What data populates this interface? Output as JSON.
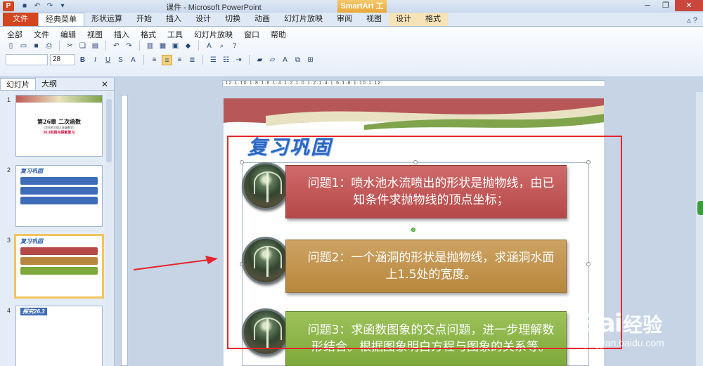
{
  "window": {
    "title": "课件 - Microsoft PowerPoint",
    "context_tool": "SmartArt 工具",
    "file_tab": "文件",
    "tabs": [
      "经典菜单",
      "形状运算",
      "开始",
      "插入",
      "设计",
      "切换",
      "动画",
      "幻灯片放映",
      "审阅",
      "视图",
      "设计",
      "格式"
    ],
    "active_tab": "经典菜单"
  },
  "ribbon": {
    "menu": [
      "全部",
      "文件",
      "编辑",
      "视图",
      "插入",
      "格式",
      "工具",
      "幻灯片放映",
      "窗口",
      "帮助"
    ],
    "font_size": "28"
  },
  "left_panel": {
    "tabs": [
      "幻灯片",
      "大纲"
    ],
    "active_tab": "幻灯片",
    "slides": [
      {
        "num": "1",
        "title": "第26章 二次函数",
        "subtitle": "（华东师大版九年级数学）",
        "heading": "26.3实践与探索复习"
      },
      {
        "num": "2",
        "title": "复习巩固"
      },
      {
        "num": "3",
        "title": "复习巩固"
      },
      {
        "num": "4",
        "title": "探究26.3"
      }
    ],
    "selected_slide": "3"
  },
  "slide": {
    "title": "复习巩固",
    "items": [
      {
        "text": "问题1：喷水池水流喷出的形状是抛物线，由已知条件求抛物线的顶点坐标；",
        "color": "#b64848"
      },
      {
        "text": "问题2：一个涵洞的形状是抛物线，求涵洞水面上1.5处的宽度。",
        "color": "#b8873d"
      },
      {
        "text": "问题3：求函数图象的交点问题，进一步理解数形结合。根据图象明白方程与图象的关系等。",
        "color": "#7ea93a"
      }
    ]
  },
  "ruler": {
    "labels": "·12·1·10·1·8·1·6·1·4·1·2·1·0·1·2·1·4·1·6·1·8·1·10·1·12·"
  },
  "watermark": {
    "brand": "Bai",
    "cn": "经验",
    "url": "jingyan.baidu.com"
  },
  "annotation_color": "#e5252b"
}
